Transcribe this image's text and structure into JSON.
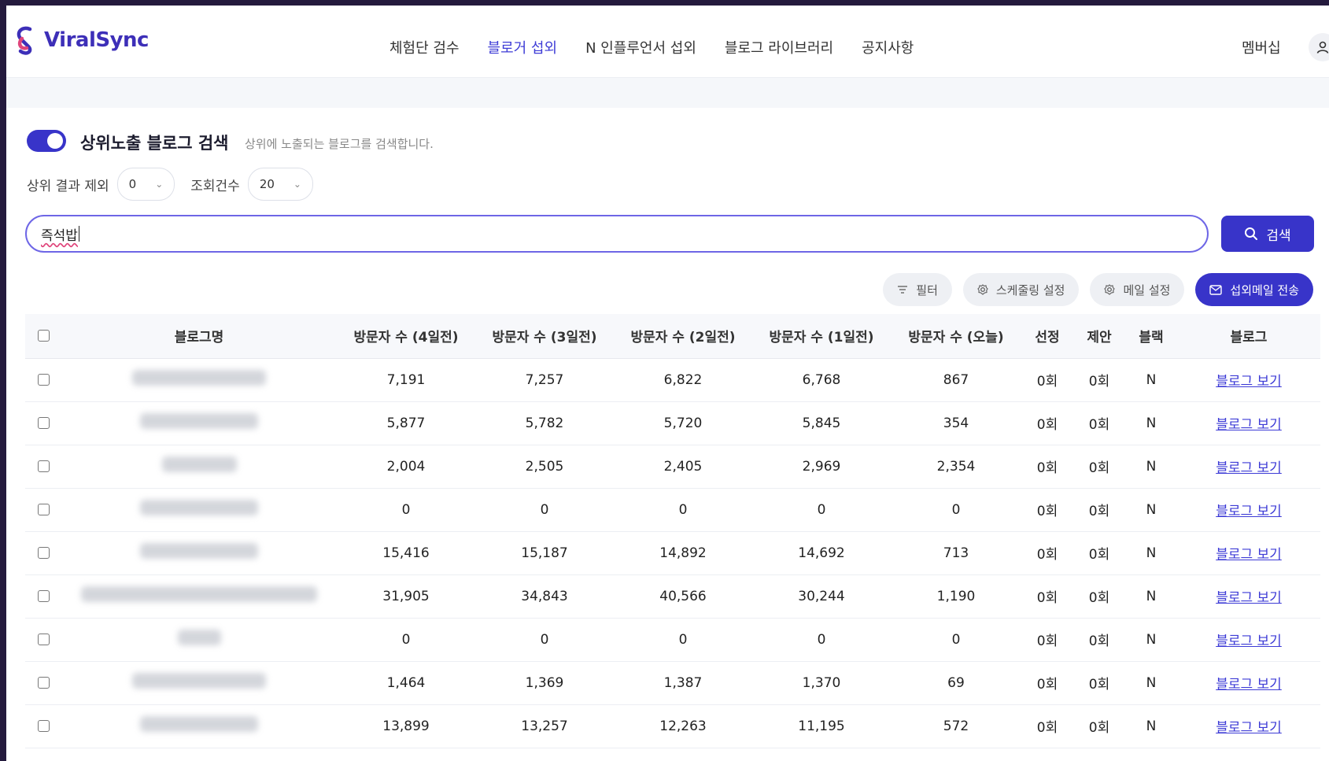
{
  "app": {
    "logo_text": "ViralSync",
    "brand_color": "#3834c9"
  },
  "nav": {
    "items": [
      {
        "label": "체험단 검수",
        "active": false
      },
      {
        "label": "블로거 섭외",
        "active": true
      },
      {
        "label": "N 인플루언서 섭외",
        "active": false
      },
      {
        "label": "블로그 라이브러리",
        "active": false
      },
      {
        "label": "공지사항",
        "active": false
      }
    ],
    "membership": "멤버십",
    "profile_icon": "user-icon"
  },
  "search_section": {
    "toggle_on": true,
    "title": "상위노출 블로그 검색",
    "description": "상위에 노출되는 블로그를 검색합니다.",
    "exclude_top_label": "상위 결과 제외",
    "exclude_top_value": "0",
    "count_label": "조회건수",
    "count_value": "20",
    "query": "즉석밥",
    "search_button": "검색"
  },
  "actions": {
    "filter": "필터",
    "scheduling": "스케줄링 설정",
    "mail_settings": "메일 설정",
    "send_mail": "섭외메일 전송"
  },
  "table": {
    "headers": [
      "블로그명",
      "방문자 수 (4일전)",
      "방문자 수 (3일전)",
      "방문자 수 (2일전)",
      "방문자 수 (1일전)",
      "방문자 수 (오늘)",
      "선정",
      "제안",
      "블랙",
      "블로그"
    ],
    "link_label": "블로그 보기",
    "rows": [
      {
        "d4": "7,191",
        "d3": "7,257",
        "d2": "6,822",
        "d1": "6,768",
        "today": "867",
        "selected": "0회",
        "proposed": "0회",
        "black": "N"
      },
      {
        "d4": "5,877",
        "d3": "5,782",
        "d2": "5,720",
        "d1": "5,845",
        "today": "354",
        "selected": "0회",
        "proposed": "0회",
        "black": "N"
      },
      {
        "d4": "2,004",
        "d3": "2,505",
        "d2": "2,405",
        "d1": "2,969",
        "today": "2,354",
        "selected": "0회",
        "proposed": "0회",
        "black": "N"
      },
      {
        "d4": "0",
        "d3": "0",
        "d2": "0",
        "d1": "0",
        "today": "0",
        "selected": "0회",
        "proposed": "0회",
        "black": "N"
      },
      {
        "d4": "15,416",
        "d3": "15,187",
        "d2": "14,892",
        "d1": "14,692",
        "today": "713",
        "selected": "0회",
        "proposed": "0회",
        "black": "N"
      },
      {
        "d4": "31,905",
        "d3": "34,843",
        "d2": "40,566",
        "d1": "30,244",
        "today": "1,190",
        "selected": "0회",
        "proposed": "0회",
        "black": "N"
      },
      {
        "d4": "0",
        "d3": "0",
        "d2": "0",
        "d1": "0",
        "today": "0",
        "selected": "0회",
        "proposed": "0회",
        "black": "N"
      },
      {
        "d4": "1,464",
        "d3": "1,369",
        "d2": "1,387",
        "d1": "1,370",
        "today": "69",
        "selected": "0회",
        "proposed": "0회",
        "black": "N"
      },
      {
        "d4": "13,899",
        "d3": "13,257",
        "d2": "12,263",
        "d1": "11,195",
        "today": "572",
        "selected": "0회",
        "proposed": "0회",
        "black": "N"
      }
    ]
  }
}
